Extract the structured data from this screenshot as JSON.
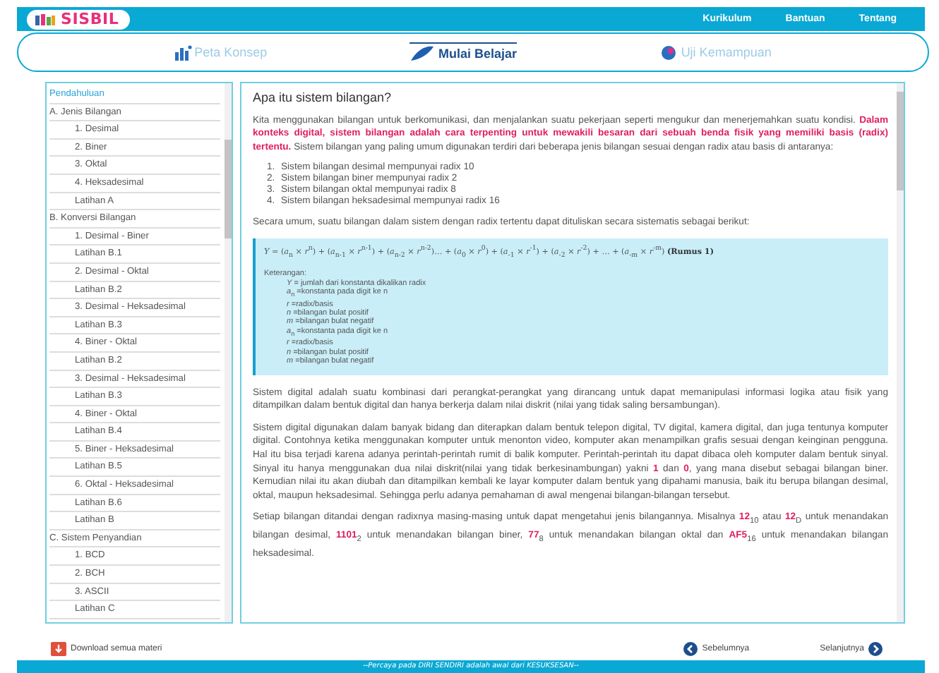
{
  "header": {
    "logo": "SISBIL",
    "links": [
      "Kurikulum",
      "Bantuan",
      "Tentang"
    ]
  },
  "tabs": [
    {
      "label": "Peta Konsep",
      "selected": false
    },
    {
      "label": "Mulai Belajar",
      "selected": true
    },
    {
      "label": "Uji Kemampuan",
      "selected": false
    }
  ],
  "sidebar": {
    "items": [
      {
        "label": "Pendahuluan",
        "selected": true
      },
      {
        "label": "A. Jenis Bilangan",
        "selected": false,
        "children": [
          {
            "label": "1. Desimal",
            "selected": false
          },
          {
            "label": "2. Biner",
            "selected": false
          },
          {
            "label": "3. Oktal",
            "selected": false
          },
          {
            "label": "4. Heksadesimal",
            "selected": false
          },
          {
            "label": "Latihan A",
            "selected": false
          }
        ]
      },
      {
        "label": "B. Konversi Bilangan",
        "selected": false,
        "children": [
          {
            "label": "1. Desimal - Biner",
            "selected": false
          },
          {
            "label": "Latihan B.1",
            "selected": false
          },
          {
            "label": "2. Desimal - Oktal",
            "selected": false
          },
          {
            "label": "Latihan B.2",
            "selected": false
          },
          {
            "label": "3. Desimal - Heksadesimal",
            "selected": false
          },
          {
            "label": "Latihan B.3",
            "selected": false
          },
          {
            "label": "4. Biner - Oktal",
            "selected": false
          },
          {
            "label": "Latihan B.2",
            "selected": false
          },
          {
            "label": "3. Desimal - Heksadesimal",
            "selected": false
          },
          {
            "label": "Latihan B.3",
            "selected": false
          },
          {
            "label": "4. Biner - Oktal",
            "selected": false
          },
          {
            "label": "Latihan B.4",
            "selected": false
          },
          {
            "label": "5. Biner - Heksadesimal",
            "selected": false
          },
          {
            "label": "Latihan B.5",
            "selected": false
          },
          {
            "label": "6. Oktal - Heksadesimal",
            "selected": false
          },
          {
            "label": "Latihan B.6",
            "selected": false
          },
          {
            "label": "Latihan B",
            "selected": false
          }
        ]
      },
      {
        "label": "C. Sistem Penyandian",
        "selected": false,
        "children": [
          {
            "label": "1. BCD",
            "selected": false
          },
          {
            "label": "2. BCH",
            "selected": false
          },
          {
            "label": "3. ASCII",
            "selected": false
          },
          {
            "label": "Latihan C",
            "selected": false
          }
        ]
      }
    ]
  },
  "content": {
    "title": "Apa itu sistem bilangan?",
    "intro": "Kita menggunakan bilangan untuk berkomunikasi, dan menjalankan suatu pekerjaan seperti mengukur dan menerjemahkan suatu kondisi. **Dalam konteks digital, sistem bilangan adalah cara terpenting untuk mewakili besaran dari sebuah benda fisik yang memiliki basis (radix) tertentu.** Sistem bilangan yang paling umum digunakan terdiri dari beberapa jenis bilangan sesuai dengan radix atau basis di antaranya:",
    "list": [
      {
        "marker": "1.",
        "text": "Sistem bilangan desimal mempunyai radix 10"
      },
      {
        "marker": "2.",
        "text": "Sistem bilangan biner mempunyai radix 2"
      },
      {
        "marker": "3.",
        "text": "Sistem bilangan oktal mempunyai radix 8"
      },
      {
        "marker": "4.",
        "text": "Sistem bilangan heksadesimal mempunyai radix 16"
      }
    ],
    "formula_intro": "Secara umum, suatu bilangan dalam sistem dengan radix tertentu dapat dituliskan secara sistematis sebagai berikut:",
    "formula": "*Y* = (*a*$_{n}$ × *r*$^{n}$) + (*a*$_{n-1}$ × *r*$^{n-1}$) + (*a*$_{n-2}$ × *r*$^{n-2}$)… + (*a*$_{0}$ × *r*$^{0}$) + (*a*$_{-1}$ × *r*$^{-1}$) + (*a*$_{-2}$ × *r*$^{-2}$) + … + (*a*$_{-m}$ × *r*$^{-m}$) **(Rumus 1)**",
    "legend_title": "Keterangan:",
    "legend": [
      "*Y* = jumlah dari konstanta dikalikan radix",
      "*a*$_{n}$ =konstanta pada digit ke n",
      "*r* =radix/basis",
      "*n* =bilangan bulat positif",
      "*m* =bilangan bulat negatif",
      "*a*$_{n}$ =konstanta pada digit ke n",
      "*r* =radix/basis",
      "*n* =bilangan bulat positif",
      "*m* =bilangan bulat negatif"
    ],
    "paragraphs": [
      "Sistem digital adalah suatu kombinasi dari perangkat-perangkat yang dirancang untuk dapat memanipulasi informasi logika atau fisik yang ditampilkan dalam bentuk digital dan hanya berkerja dalam nilai diskrit (nilai yang tidak saling bersambungan).",
      "Sistem digital digunakan dalam banyak bidang dan diterapkan dalam bentuk telepon digital, TV digital, kamera digital, dan juga tentunya komputer digital. Contohnya ketika menggunakan komputer untuk menonton video, komputer akan menampilkan grafis sesuai dengan keinginan pengguna. Hal itu bisa terjadi karena adanya perintah-perintah rumit di balik komputer. Perintah-perintah itu dapat dibaca oleh komputer dalam bentuk sinyal. Sinyal itu hanya menggunakan dua nilai diskrit(nilai yang tidak berkesinambungan) yakni **1** dan **0**, yang mana disebut sebagai bilangan biner. Kemudian nilai itu akan diubah dan ditampilkan kembali ke layar komputer dalam bentuk yang dipahami manusia, baik itu berupa bilangan desimal, oktal, maupun heksadesimal. Sehingga perlu adanya pemahaman di awal mengenai bilangan-bilangan tersebut.",
      "Setiap bilangan ditandai dengan radixnya masing-masing untuk dapat mengetahui jenis bilangannya. Misalnya **12**$_{10}$ atau **12**$_{D}$ untuk menandakan bilangan desimal, **1101**$_{2}$ untuk menandakan bilangan biner, **77**$_{8}$ untuk menandakan bilangan oktal dan **AF5**$_{16}$ untuk menandakan bilangan heksadesimal."
    ]
  },
  "download": "Download semua materi",
  "prev": "Sebelumnya",
  "next": "Selanjutnya",
  "footer": "--Percaya pada DIRI SENDIRI adalah awal dari KESUKSESAN--"
}
